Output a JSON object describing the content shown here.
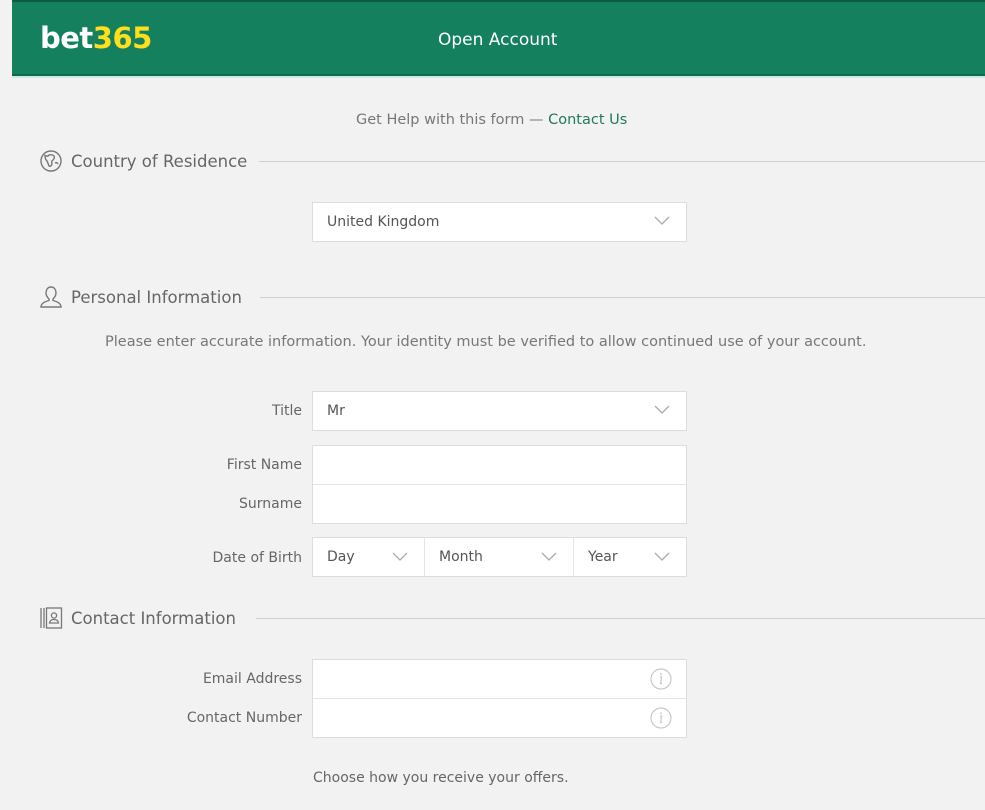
{
  "header": {
    "logo_main": "bet",
    "logo_accent": "365",
    "title": "Open Account",
    "colors": {
      "brand_green": "#14805e",
      "logo_yellow": "#ffdf1b"
    }
  },
  "help": {
    "text": "Get Help with this form — ",
    "link": "Contact Us"
  },
  "sections": {
    "country": {
      "icon": "globe-icon",
      "label": "Country of Residence",
      "select_value": "United Kingdom"
    },
    "personal": {
      "icon": "person-icon",
      "label": "Personal Information",
      "note": "Please enter accurate information. Your identity must be verified to allow continued use of your account.",
      "fields": {
        "title_label": "Title",
        "title_value": "Mr",
        "first_name_label": "First Name",
        "first_name_value": "",
        "surname_label": "Surname",
        "surname_value": "",
        "dob_label": "Date of Birth",
        "dob_day": "Day",
        "dob_month": "Month",
        "dob_year": "Year"
      }
    },
    "contact": {
      "icon": "address-book-icon",
      "label": "Contact Information",
      "fields": {
        "email_label": "Email Address",
        "email_value": "",
        "phone_label": "Contact Number",
        "phone_value": ""
      },
      "offers_note": "Choose how you receive your offers."
    }
  }
}
